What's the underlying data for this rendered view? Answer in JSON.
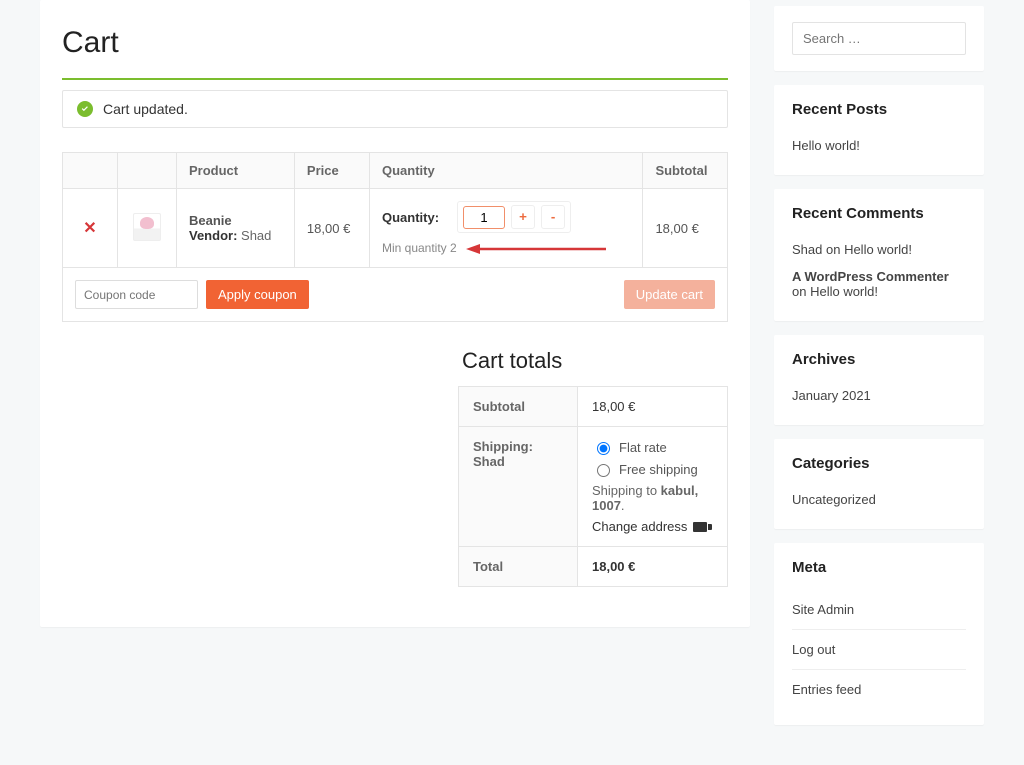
{
  "page_title": "Cart",
  "notice_text": "Cart updated.",
  "table": {
    "headers": {
      "product": "Product",
      "price": "Price",
      "quantity": "Quantity",
      "subtotal": "Subtotal"
    },
    "row": {
      "product_name": "Beanie",
      "vendor_label": "Vendor:",
      "vendor_name": "Shad",
      "price": "18,00 €",
      "quantity_label": "Quantity:",
      "quantity_value": "1",
      "min_quantity_text": "Min quantity 2",
      "subtotal": "18,00 €"
    },
    "coupon_placeholder": "Coupon code",
    "apply_coupon_label": "Apply coupon",
    "update_cart_label": "Update cart"
  },
  "cart_totals": {
    "heading": "Cart totals",
    "subtotal_label": "Subtotal",
    "subtotal_value": "18,00 €",
    "shipping_label": "Shipping: Shad",
    "flat_rate_label": "Flat rate",
    "free_shipping_label": "Free shipping",
    "shipping_to_prefix": "Shipping to ",
    "shipping_to_location": "kabul, 1007",
    "change_address_label": "Change address",
    "total_label": "Total",
    "total_value": "18,00 €"
  },
  "sidebar": {
    "search_placeholder": "Search …",
    "recent_posts": {
      "title": "Recent Posts",
      "items": [
        "Hello world!"
      ]
    },
    "recent_comments": {
      "title": "Recent Comments",
      "items": [
        {
          "author": "Shad",
          "on": " on ",
          "post": "Hello world!"
        },
        {
          "author": "A WordPress Commenter",
          "on": " on ",
          "post": "Hello world!"
        }
      ]
    },
    "archives": {
      "title": "Archives",
      "items": [
        "January 2021"
      ]
    },
    "categories": {
      "title": "Categories",
      "items": [
        "Uncategorized"
      ]
    },
    "meta": {
      "title": "Meta",
      "items": [
        "Site Admin",
        "Log out",
        "Entries feed"
      ]
    }
  }
}
